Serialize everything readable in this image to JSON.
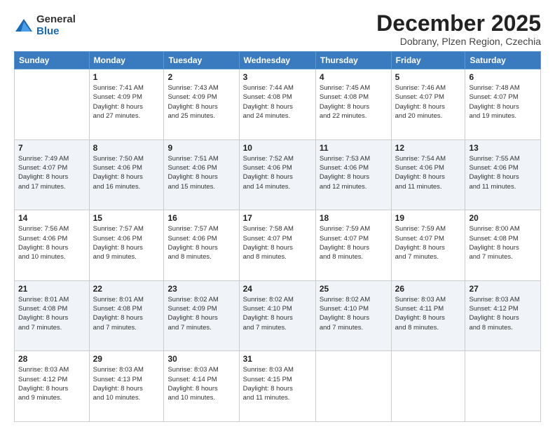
{
  "logo": {
    "general": "General",
    "blue": "Blue"
  },
  "header": {
    "month": "December 2025",
    "location": "Dobrany, Plzen Region, Czechia"
  },
  "weekdays": [
    "Sunday",
    "Monday",
    "Tuesday",
    "Wednesday",
    "Thursday",
    "Friday",
    "Saturday"
  ],
  "weeks": [
    [
      {
        "day": "",
        "info": ""
      },
      {
        "day": "1",
        "info": "Sunrise: 7:41 AM\nSunset: 4:09 PM\nDaylight: 8 hours\nand 27 minutes."
      },
      {
        "day": "2",
        "info": "Sunrise: 7:43 AM\nSunset: 4:09 PM\nDaylight: 8 hours\nand 25 minutes."
      },
      {
        "day": "3",
        "info": "Sunrise: 7:44 AM\nSunset: 4:08 PM\nDaylight: 8 hours\nand 24 minutes."
      },
      {
        "day": "4",
        "info": "Sunrise: 7:45 AM\nSunset: 4:08 PM\nDaylight: 8 hours\nand 22 minutes."
      },
      {
        "day": "5",
        "info": "Sunrise: 7:46 AM\nSunset: 4:07 PM\nDaylight: 8 hours\nand 20 minutes."
      },
      {
        "day": "6",
        "info": "Sunrise: 7:48 AM\nSunset: 4:07 PM\nDaylight: 8 hours\nand 19 minutes."
      }
    ],
    [
      {
        "day": "7",
        "info": "Sunrise: 7:49 AM\nSunset: 4:07 PM\nDaylight: 8 hours\nand 17 minutes."
      },
      {
        "day": "8",
        "info": "Sunrise: 7:50 AM\nSunset: 4:06 PM\nDaylight: 8 hours\nand 16 minutes."
      },
      {
        "day": "9",
        "info": "Sunrise: 7:51 AM\nSunset: 4:06 PM\nDaylight: 8 hours\nand 15 minutes."
      },
      {
        "day": "10",
        "info": "Sunrise: 7:52 AM\nSunset: 4:06 PM\nDaylight: 8 hours\nand 14 minutes."
      },
      {
        "day": "11",
        "info": "Sunrise: 7:53 AM\nSunset: 4:06 PM\nDaylight: 8 hours\nand 12 minutes."
      },
      {
        "day": "12",
        "info": "Sunrise: 7:54 AM\nSunset: 4:06 PM\nDaylight: 8 hours\nand 11 minutes."
      },
      {
        "day": "13",
        "info": "Sunrise: 7:55 AM\nSunset: 4:06 PM\nDaylight: 8 hours\nand 11 minutes."
      }
    ],
    [
      {
        "day": "14",
        "info": "Sunrise: 7:56 AM\nSunset: 4:06 PM\nDaylight: 8 hours\nand 10 minutes."
      },
      {
        "day": "15",
        "info": "Sunrise: 7:57 AM\nSunset: 4:06 PM\nDaylight: 8 hours\nand 9 minutes."
      },
      {
        "day": "16",
        "info": "Sunrise: 7:57 AM\nSunset: 4:06 PM\nDaylight: 8 hours\nand 8 minutes."
      },
      {
        "day": "17",
        "info": "Sunrise: 7:58 AM\nSunset: 4:07 PM\nDaylight: 8 hours\nand 8 minutes."
      },
      {
        "day": "18",
        "info": "Sunrise: 7:59 AM\nSunset: 4:07 PM\nDaylight: 8 hours\nand 8 minutes."
      },
      {
        "day": "19",
        "info": "Sunrise: 7:59 AM\nSunset: 4:07 PM\nDaylight: 8 hours\nand 7 minutes."
      },
      {
        "day": "20",
        "info": "Sunrise: 8:00 AM\nSunset: 4:08 PM\nDaylight: 8 hours\nand 7 minutes."
      }
    ],
    [
      {
        "day": "21",
        "info": "Sunrise: 8:01 AM\nSunset: 4:08 PM\nDaylight: 8 hours\nand 7 minutes."
      },
      {
        "day": "22",
        "info": "Sunrise: 8:01 AM\nSunset: 4:08 PM\nDaylight: 8 hours\nand 7 minutes."
      },
      {
        "day": "23",
        "info": "Sunrise: 8:02 AM\nSunset: 4:09 PM\nDaylight: 8 hours\nand 7 minutes."
      },
      {
        "day": "24",
        "info": "Sunrise: 8:02 AM\nSunset: 4:10 PM\nDaylight: 8 hours\nand 7 minutes."
      },
      {
        "day": "25",
        "info": "Sunrise: 8:02 AM\nSunset: 4:10 PM\nDaylight: 8 hours\nand 7 minutes."
      },
      {
        "day": "26",
        "info": "Sunrise: 8:03 AM\nSunset: 4:11 PM\nDaylight: 8 hours\nand 8 minutes."
      },
      {
        "day": "27",
        "info": "Sunrise: 8:03 AM\nSunset: 4:12 PM\nDaylight: 8 hours\nand 8 minutes."
      }
    ],
    [
      {
        "day": "28",
        "info": "Sunrise: 8:03 AM\nSunset: 4:12 PM\nDaylight: 8 hours\nand 9 minutes."
      },
      {
        "day": "29",
        "info": "Sunrise: 8:03 AM\nSunset: 4:13 PM\nDaylight: 8 hours\nand 10 minutes."
      },
      {
        "day": "30",
        "info": "Sunrise: 8:03 AM\nSunset: 4:14 PM\nDaylight: 8 hours\nand 10 minutes."
      },
      {
        "day": "31",
        "info": "Sunrise: 8:03 AM\nSunset: 4:15 PM\nDaylight: 8 hours\nand 11 minutes."
      },
      {
        "day": "",
        "info": ""
      },
      {
        "day": "",
        "info": ""
      },
      {
        "day": "",
        "info": ""
      }
    ]
  ]
}
